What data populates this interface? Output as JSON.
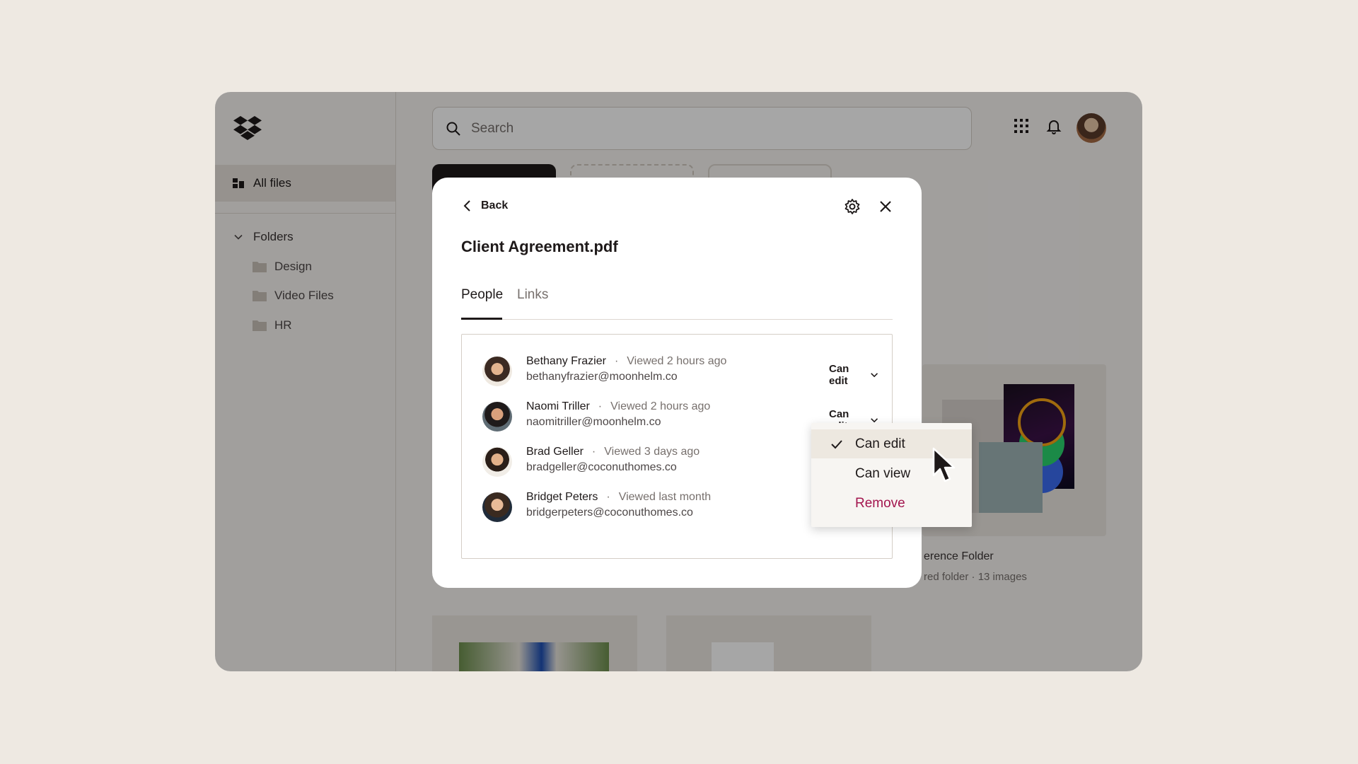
{
  "sidebar": {
    "all_files_label": "All files",
    "folders_label": "Folders",
    "folders": [
      {
        "label": "Design"
      },
      {
        "label": "Video Files"
      },
      {
        "label": "HR"
      }
    ]
  },
  "topbar": {
    "search_placeholder": "Search"
  },
  "background": {
    "reference_folder_title": "erence Folder",
    "reference_folder_subtitle": "red folder · 13 images"
  },
  "modal": {
    "back_label": "Back",
    "file_title": "Client Agreement.pdf",
    "tabs": [
      {
        "label": "People",
        "active": true
      },
      {
        "label": "Links",
        "active": false
      }
    ],
    "people": [
      {
        "name": "Bethany Frazier",
        "activity": "Viewed 2 hours ago",
        "email": "bethanyfrazier@moonhelm.co",
        "permission": "Can edit"
      },
      {
        "name": "Naomi Triller",
        "activity": "Viewed 2 hours ago",
        "email": "naomitriller@moonhelm.co",
        "permission": "Can edit"
      },
      {
        "name": "Brad Geller",
        "activity": "Viewed 3 days ago",
        "email": "bradgeller@coconuthomes.co",
        "permission": ""
      },
      {
        "name": "Bridget Peters",
        "activity": "Viewed last month",
        "email": "bridgerpeters@coconuthomes.co",
        "permission": ""
      }
    ],
    "separator": "·"
  },
  "dropdown": {
    "options": [
      {
        "label": "Can edit",
        "selected": true
      },
      {
        "label": "Can view",
        "selected": false
      },
      {
        "label": "Remove",
        "selected": false
      }
    ]
  },
  "colors": {
    "background": "#eee9e2",
    "accent_dark": "#1e1919",
    "remove_red": "#a3154e",
    "dropbox_blue": "#0061fe"
  }
}
